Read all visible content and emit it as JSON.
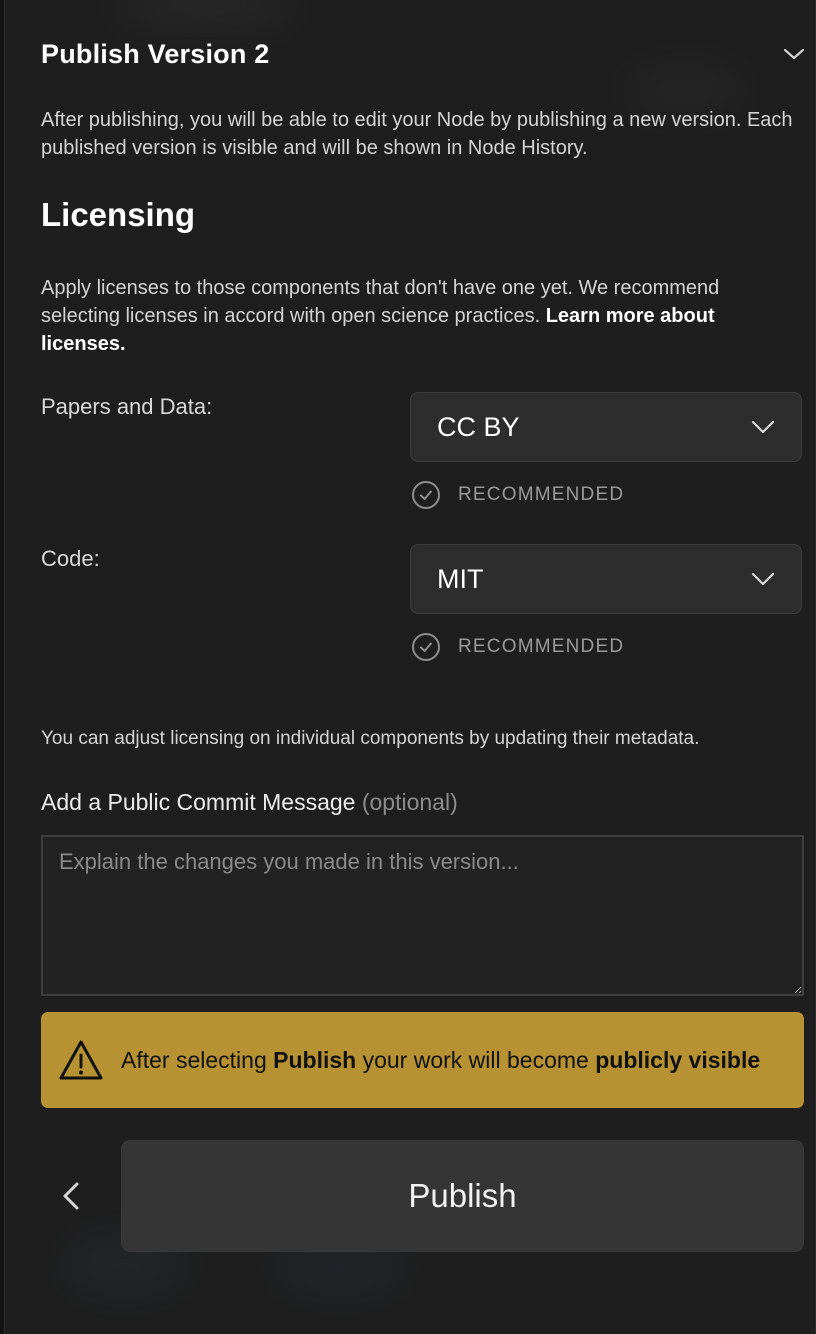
{
  "header": {
    "title": "Publish Version 2",
    "collapse_icon": "chevron-down-icon"
  },
  "intro": "After publishing, you will be able to edit your Node by publishing a new version. Each published version is visible and will be shown in Node History.",
  "licensing": {
    "title": "Licensing",
    "description": "Apply licenses to those components that don't have one yet. We recommend selecting licenses in accord with open science practices.",
    "learn_more": "Learn more about licenses.",
    "fields": [
      {
        "label": "Papers and Data:",
        "value": "CC BY",
        "recommended": "RECOMMENDED"
      },
      {
        "label": "Code:",
        "value": "MIT",
        "recommended": "RECOMMENDED"
      }
    ],
    "adjust_note": "You can adjust licensing on individual components by updating their metadata."
  },
  "commit": {
    "label": "Add a Public Commit Message",
    "optional": "(optional)",
    "placeholder": "Explain the changes you made in this version...",
    "value": ""
  },
  "warning": {
    "prefix": "After selecting",
    "publish_word": "Publish",
    "middle": "your work will become",
    "emphasis": "publicly visible",
    "icon": "warning-triangle-icon"
  },
  "footer": {
    "back_icon": "chevron-left-icon",
    "publish_label": "Publish"
  },
  "colors": {
    "panel_bg": "#1e1e1e",
    "select_bg": "#2d2d2d",
    "warning_bg": "#b69232",
    "publish_bg": "#353535"
  }
}
